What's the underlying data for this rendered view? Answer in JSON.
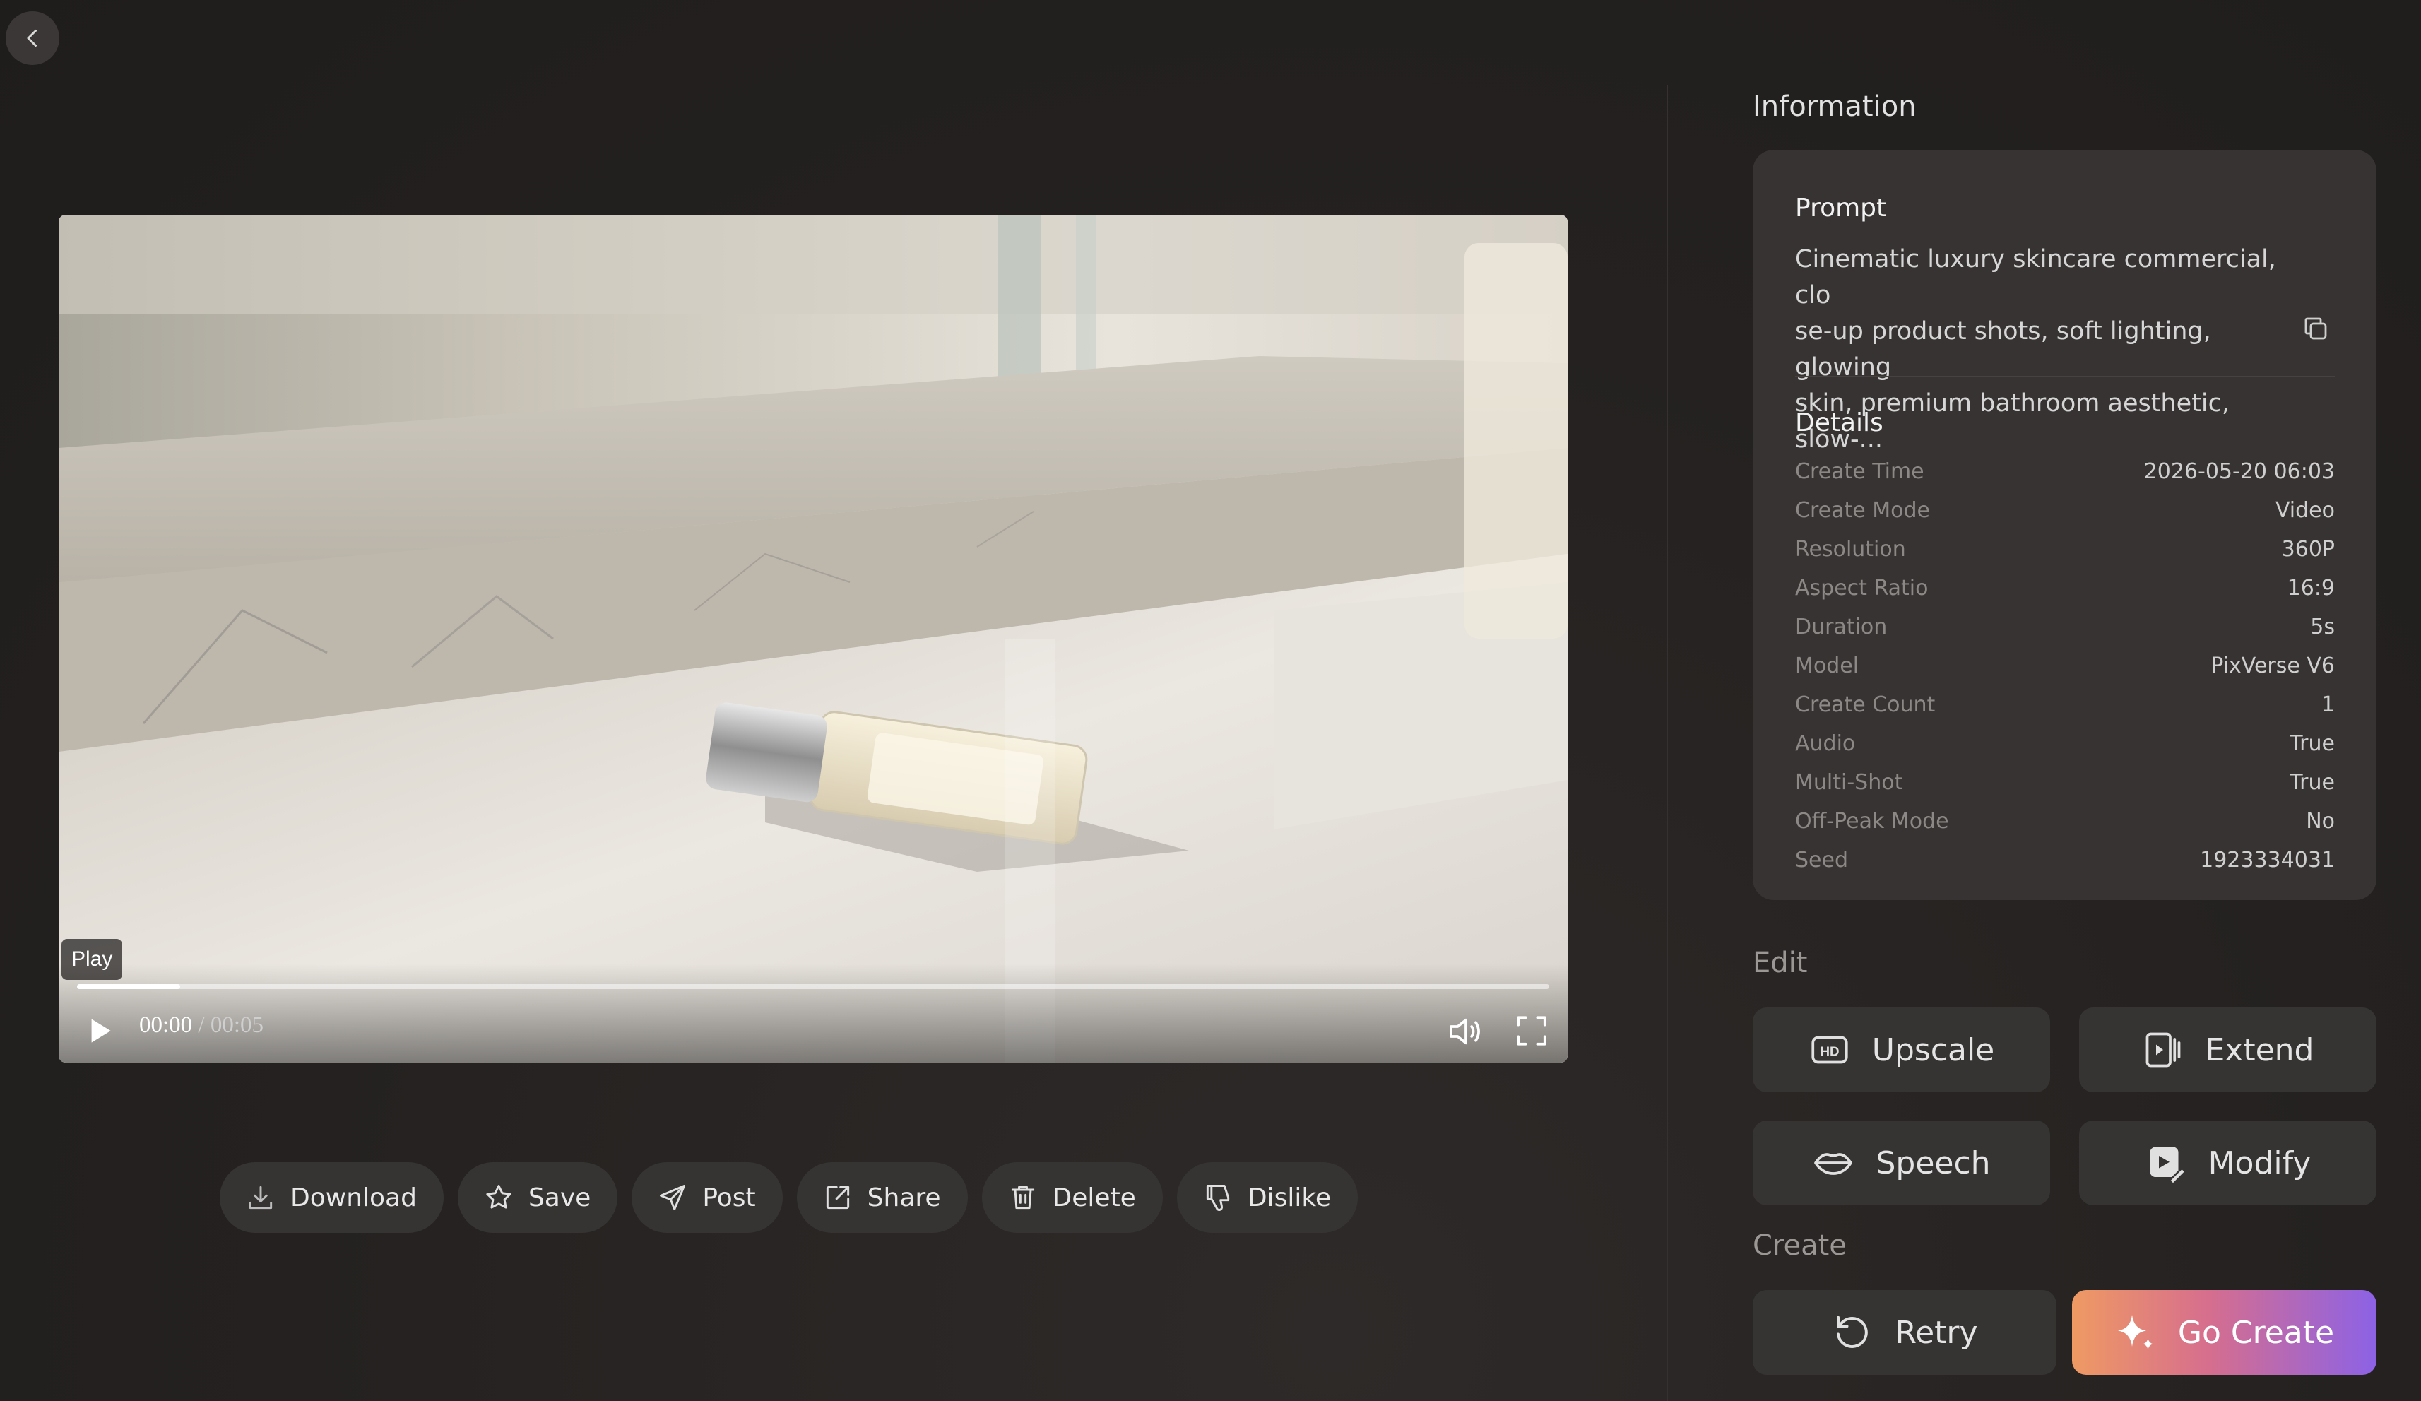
{
  "nav": {
    "back_icon": "chevron-left-icon"
  },
  "player": {
    "play_tooltip": "Play",
    "current_time": "00:00",
    "separator": " / ",
    "duration": "00:05",
    "progress": 0.07,
    "icons": {
      "play": "play-icon",
      "volume": "volume-icon",
      "fullscreen": "fullscreen-icon"
    }
  },
  "actions": [
    {
      "label": "Download",
      "icon": "download-icon"
    },
    {
      "label": "Save",
      "icon": "star-icon"
    },
    {
      "label": "Post",
      "icon": "send-icon"
    },
    {
      "label": "Share",
      "icon": "share-icon"
    },
    {
      "label": "Delete",
      "icon": "trash-icon"
    },
    {
      "label": "Dislike",
      "icon": "thumbs-down-icon"
    }
  ],
  "info": {
    "title": "Information",
    "prompt_heading": "Prompt",
    "prompt_lines": [
      "Cinematic luxury skincare commercial, clo",
      "se-up product shots, soft lighting, glowing",
      "skin, premium bathroom aesthetic, slow-..."
    ],
    "details_heading": "Details",
    "details": [
      {
        "key": "Create Time",
        "value": "2026-05-20 06:03"
      },
      {
        "key": "Create Mode",
        "value": "Video"
      },
      {
        "key": "Resolution",
        "value": "360P"
      },
      {
        "key": "Aspect Ratio",
        "value": "16:9"
      },
      {
        "key": "Duration",
        "value": "5s"
      },
      {
        "key": "Model",
        "value": "PixVerse V6"
      },
      {
        "key": "Create Count",
        "value": "1"
      },
      {
        "key": "Audio",
        "value": "True"
      },
      {
        "key": "Multi-Shot",
        "value": "True"
      },
      {
        "key": "Off-Peak Mode",
        "value": "No"
      },
      {
        "key": "Seed",
        "value": "1923334031"
      }
    ]
  },
  "edit": {
    "title": "Edit",
    "upscale": "Upscale",
    "extend": "Extend",
    "speech": "Speech",
    "modify": "Modify"
  },
  "create": {
    "title": "Create",
    "retry": "Retry",
    "go_create": "Go Create"
  },
  "colors": {
    "background": "#242120",
    "panel": "#363332",
    "button": "#363433",
    "accent_gradient_start": "#ef9a63",
    "accent_gradient_end": "#8c62e6"
  }
}
